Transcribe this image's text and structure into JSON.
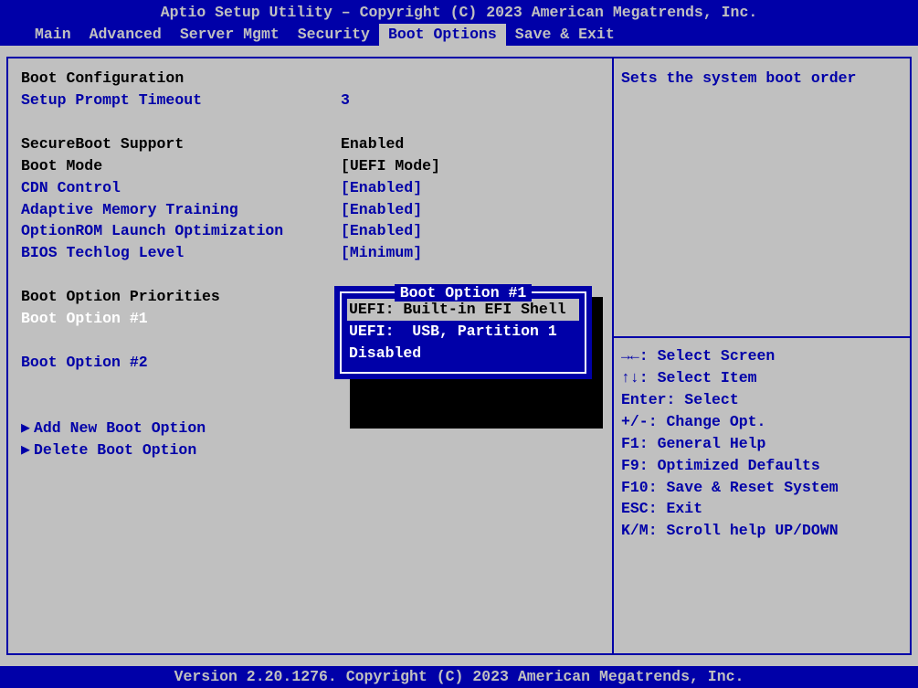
{
  "header": {
    "title": "Aptio Setup Utility – Copyright (C) 2023 American Megatrends, Inc."
  },
  "tabs": {
    "items": [
      {
        "label": "Main"
      },
      {
        "label": "Advanced"
      },
      {
        "label": "Server Mgmt"
      },
      {
        "label": "Security"
      },
      {
        "label": "Boot Options"
      },
      {
        "label": "Save & Exit"
      }
    ],
    "active_index": 4
  },
  "left": {
    "section1_title": "Boot Configuration",
    "setup_prompt_timeout_label": "Setup Prompt Timeout",
    "setup_prompt_timeout_value": "3",
    "secureboot_label": "SecureBoot Support",
    "secureboot_value": "Enabled",
    "boot_mode_label": "Boot Mode",
    "boot_mode_value": "[UEFI Mode]",
    "cdn_label": "CDN Control",
    "cdn_value": "[Enabled]",
    "amt_label": "Adaptive Memory Training",
    "amt_value": "[Enabled]",
    "orlo_label": "OptionROM Launch Optimization",
    "orlo_value": "[Enabled]",
    "btl_label": "BIOS Techlog Level",
    "btl_value": "[Minimum]",
    "priorities_title": "Boot Option Priorities",
    "bo1_label": "Boot Option #1",
    "bo2_label": "Boot Option #2",
    "add_label": "Add New Boot Option",
    "del_label": "Delete Boot Option"
  },
  "popup": {
    "title": " Boot Option #1 ",
    "items": [
      {
        "label": "UEFI: Built-in EFI Shell"
      },
      {
        "label": "UEFI:  USB, Partition 1"
      },
      {
        "label": "Disabled"
      }
    ],
    "selected_index": 0
  },
  "right": {
    "help_text": "Sets the system boot order",
    "keys": [
      "→←: Select Screen",
      "↑↓: Select Item",
      "Enter: Select",
      "+/-: Change Opt.",
      "F1: General Help",
      "F9: Optimized Defaults",
      "F10: Save & Reset System",
      "ESC: Exit",
      "K/M: Scroll help UP/DOWN"
    ]
  },
  "footer": {
    "text": "Version 2.20.1276. Copyright (C) 2023 American Megatrends, Inc."
  }
}
